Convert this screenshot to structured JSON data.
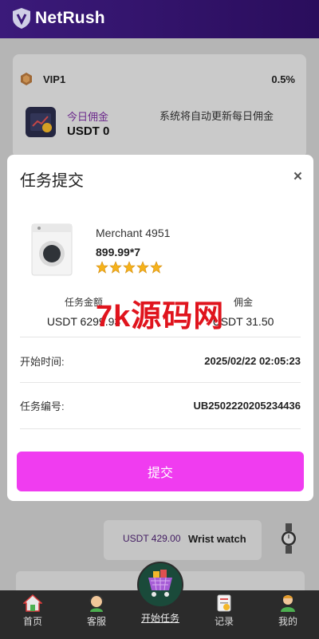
{
  "header": {
    "brand": "NetRush"
  },
  "vip": {
    "level": "VIP1",
    "rate": "0.5%"
  },
  "commission": {
    "title": "今日佣金",
    "value": "USDT 0",
    "note": "系统将自动更新每日佣金"
  },
  "modal": {
    "title": "任务提交",
    "close": "×",
    "product": {
      "merchant": "Merchant 4951",
      "price_qty": "899.99*7",
      "rating": 5
    },
    "summary": {
      "amount_label": "任务金额",
      "amount_value": "USDT 6299.93",
      "return_label": "",
      "return_value": "",
      "commission_label": "佣金",
      "commission_value": "USDT 31.50"
    },
    "start_time_label": "开始时间:",
    "start_time_value": "2025/02/22 02:05:23",
    "task_no_label": "任务编号:",
    "task_no_value": "UB2502220205234436",
    "submit_label": "提交"
  },
  "watermark": "7k源码网",
  "background_items": [
    {
      "price": "USDT 429.00",
      "name": "Wrist watch"
    }
  ],
  "nav": {
    "home": "首页",
    "service": "客服",
    "start_task": "开始任务",
    "records": "记录",
    "mine": "我的"
  },
  "colors": {
    "header": "#3b1a7a",
    "submit": "#f03cf0",
    "watermark": "#e0141d",
    "star": "#f5b21b"
  }
}
